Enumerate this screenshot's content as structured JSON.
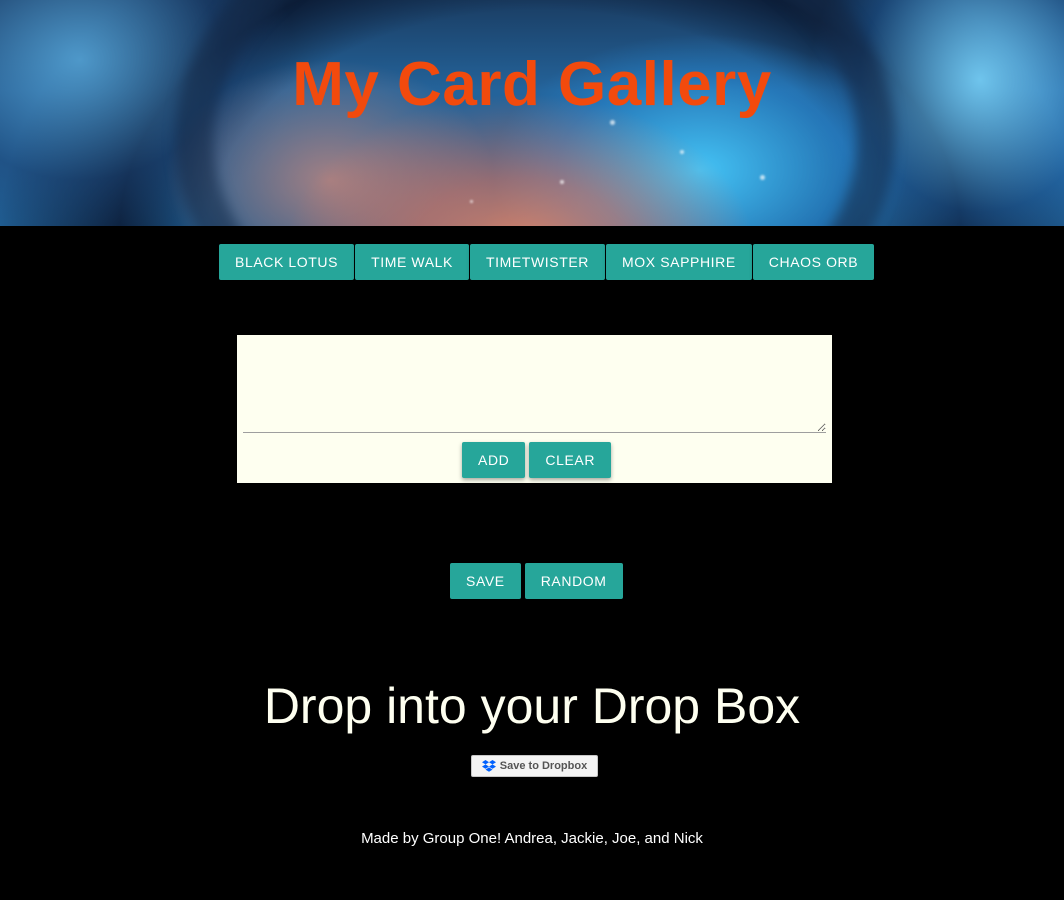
{
  "header": {
    "title": "My Card Gallery"
  },
  "nav": {
    "buttons": [
      "BLACK LOTUS",
      "TIME WALK",
      "TIMETWISTER",
      "MOX SAPPHIRE",
      "CHAOS ORB"
    ]
  },
  "card_form": {
    "input_value": "",
    "add_label": "ADD",
    "clear_label": "CLEAR"
  },
  "actions": {
    "save_label": "SAVE",
    "random_label": "RANDOM"
  },
  "dropbox": {
    "heading": "Drop into your Drop Box",
    "button_label": "Save to Dropbox",
    "icon": "dropbox-icon"
  },
  "footer": {
    "text": "Made by Group One! Andrea, Jackie, Joe, and Nick"
  },
  "colors": {
    "title": "#f24a0d",
    "button": "#26a69a",
    "background": "#000000",
    "card_background": "#fefff0",
    "dropbox_blue": "#0061fe"
  }
}
